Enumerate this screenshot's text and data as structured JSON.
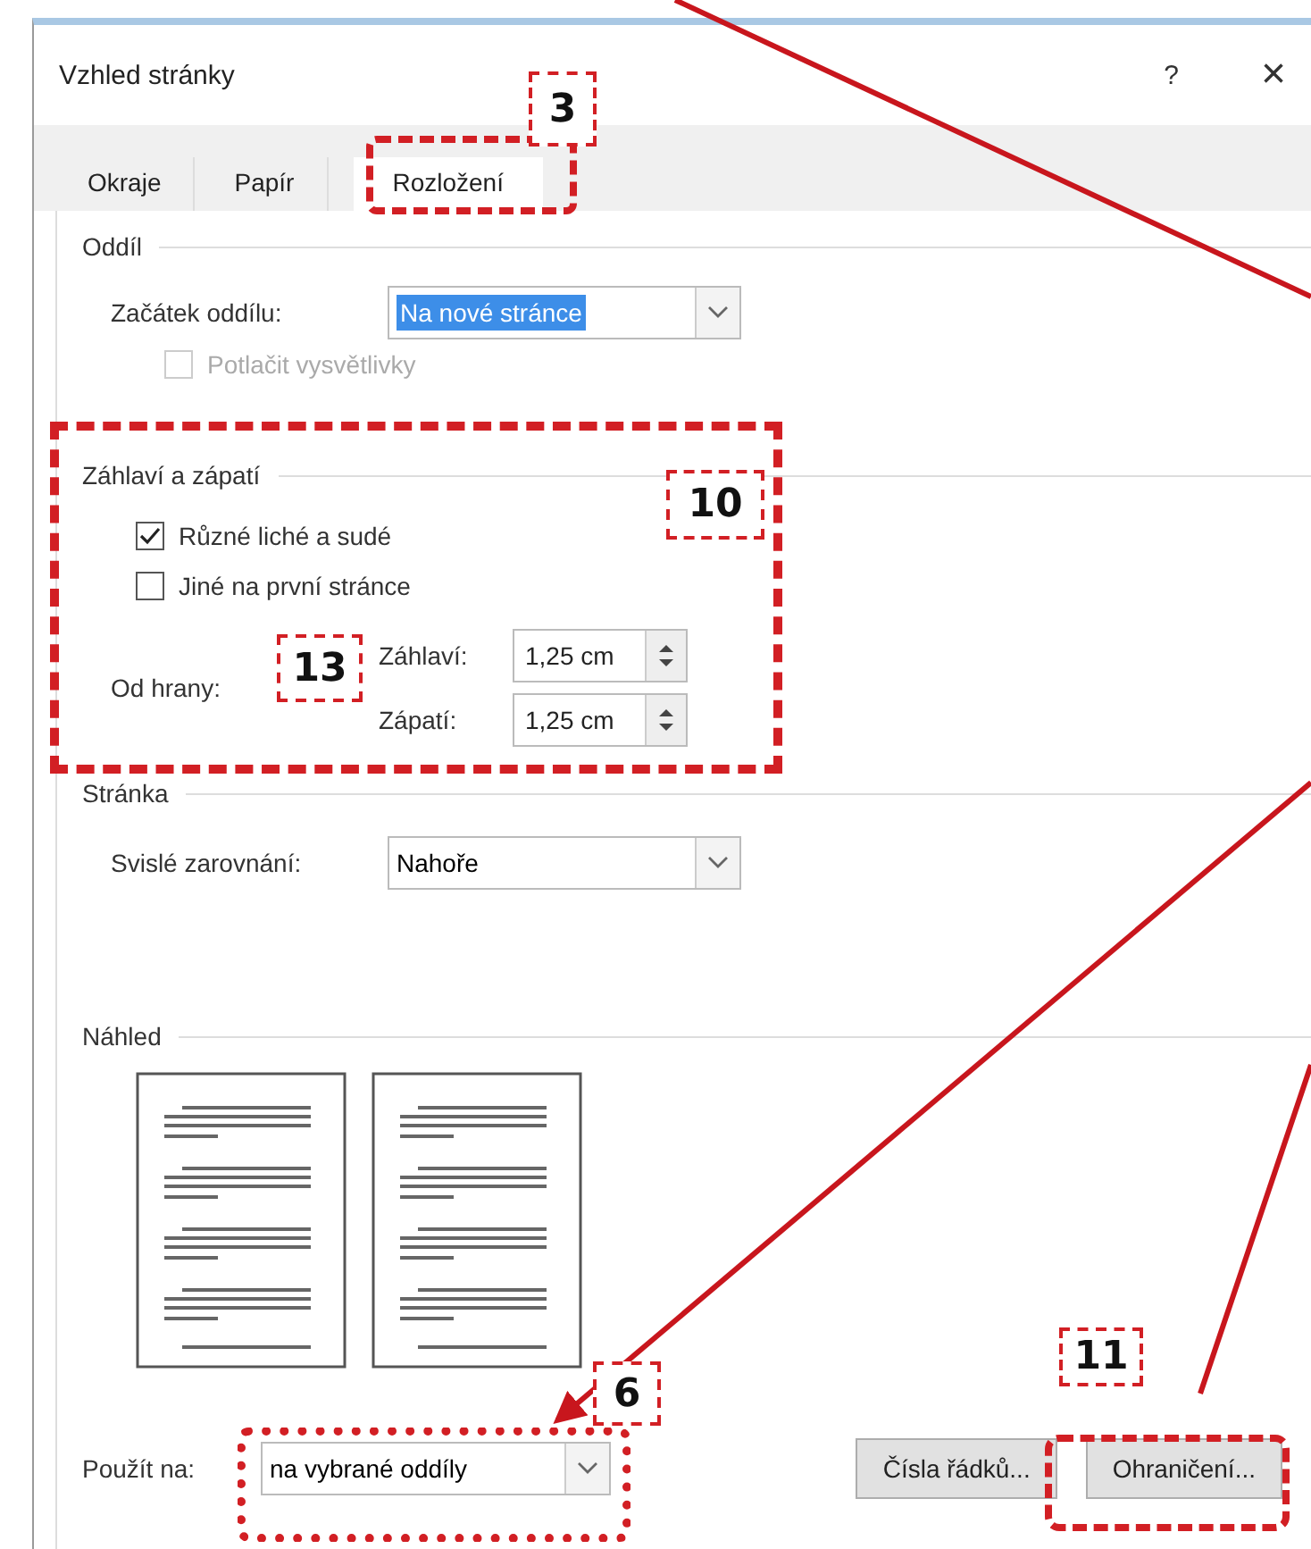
{
  "window": {
    "title": "Vzhled stránky",
    "help": "?",
    "close": "×"
  },
  "tabs": [
    {
      "label": "Okraje",
      "selected": false
    },
    {
      "label": "Papír",
      "selected": false
    },
    {
      "label": "Rozložení",
      "selected": true
    }
  ],
  "section": {
    "title": "Oddíl",
    "start_label": "Začátek oddílu:",
    "start_value": "Na nové stránce",
    "start_focused": true,
    "suppress_label": "Potlačit vysvětlivky",
    "suppress_checked": false,
    "suppress_disabled": true
  },
  "header_footer": {
    "title": "Záhlaví a zápatí",
    "options": [
      {
        "label": "Různé liché a sudé",
        "checked": true
      },
      {
        "label": "Jiné na první stránce",
        "checked": false
      }
    ],
    "from_edge_label": "Od hrany:",
    "fields": [
      {
        "label": "Záhlaví:",
        "value": "1,25 cm"
      },
      {
        "label": "Zápatí:",
        "value": "1,25 cm"
      }
    ]
  },
  "page": {
    "title": "Stránka",
    "align_label": "Svislé zarovnání:",
    "align_value": "Nahoře"
  },
  "preview": {
    "title": "Náhled"
  },
  "apply": {
    "label": "Použít na:",
    "value": "na vybrané oddíly"
  },
  "buttons": [
    "Čísla řádků...",
    "Ohraničení..."
  ],
  "annotations": [
    {
      "label": "3"
    },
    {
      "label": "10"
    },
    {
      "label": "13"
    },
    {
      "label": "6"
    },
    {
      "label": "11"
    }
  ]
}
